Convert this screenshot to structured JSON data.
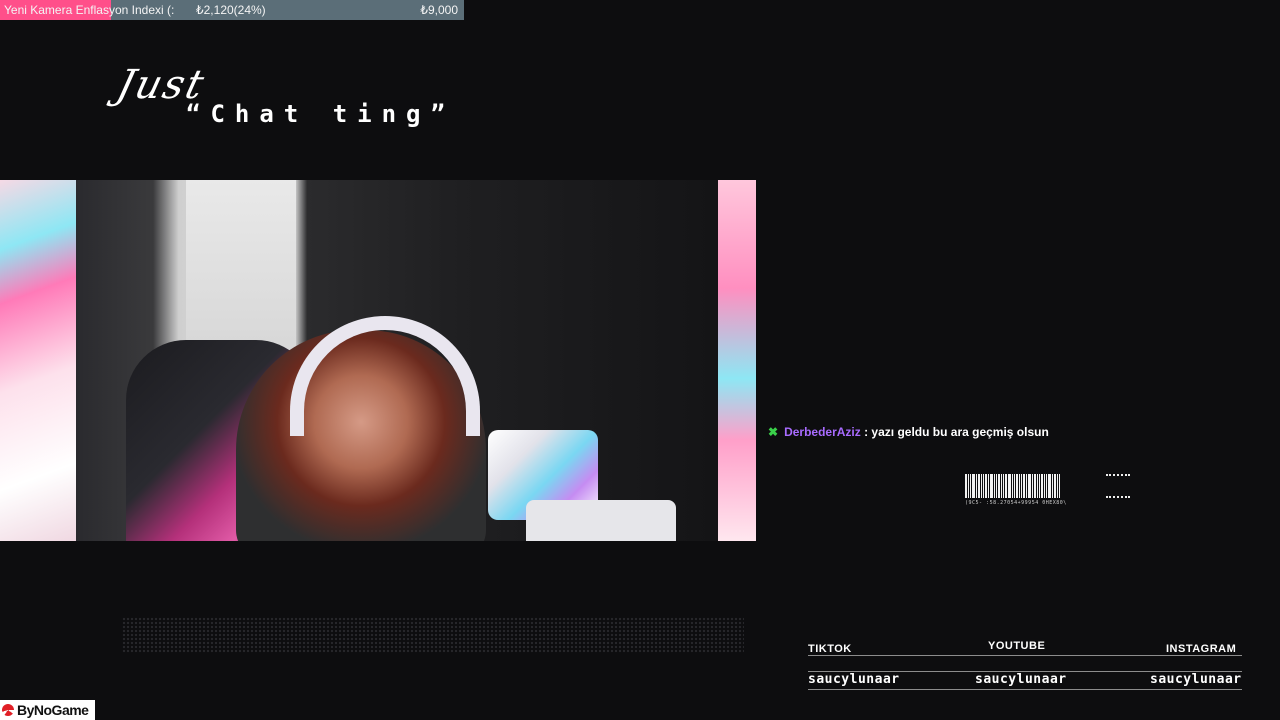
{
  "goal_bar": {
    "title": "Yeni Kamera Enflasyon Indexi (:",
    "raised": "₺2,120(24%)",
    "target": "₺9,000",
    "progress_percent": 24,
    "fill_color": "#ff4f8a",
    "track_color": "#5b6e78"
  },
  "scene_title": {
    "line1": "Just",
    "line2": "“Chat ting”"
  },
  "chat": {
    "badge_icon": "green-x-badge",
    "username": "DerbederAziz",
    "separator": " : ",
    "message": "yazı geldu bu ara geçmiş olsun",
    "username_color": "#a86bff"
  },
  "barcode": {
    "caption": "(9C5- :58.27054+99954 0HEX80\\"
  },
  "socials": [
    {
      "platform": "TIKTOK",
      "handle": "saucylunaar"
    },
    {
      "platform": "YOUTUBE",
      "handle": "saucylunaar"
    },
    {
      "platform": "INSTAGRAM",
      "handle": "saucylunaar"
    }
  ],
  "watermark": {
    "text": "ByNoGame",
    "icon": "bynogame-logo"
  }
}
